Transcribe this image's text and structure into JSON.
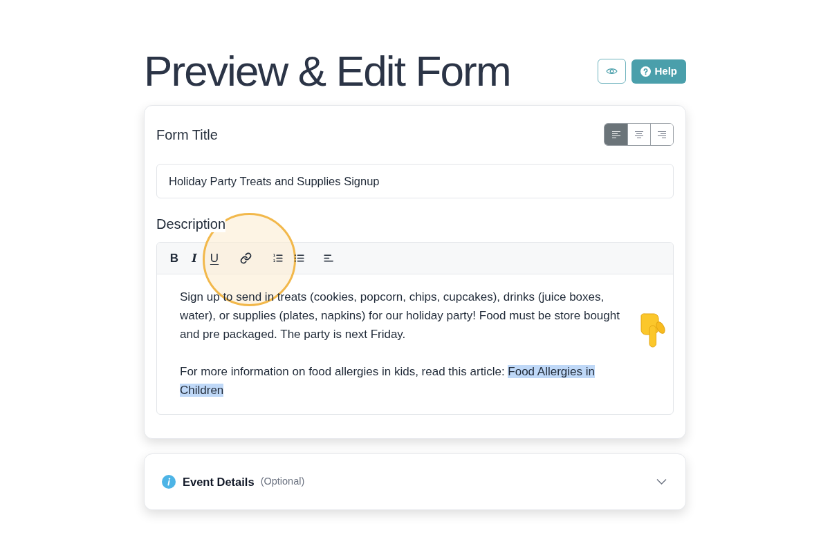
{
  "page": {
    "title": "Preview & Edit Form"
  },
  "header_buttons": [
    {
      "kind": "preview"
    },
    {
      "kind": "help",
      "label": "Help"
    }
  ],
  "form_card": {
    "title_label": "Form Title",
    "alignment": [
      {
        "kind": "left",
        "selected": true
      },
      {
        "kind": "center",
        "selected": false
      },
      {
        "kind": "right",
        "selected": false
      }
    ],
    "title_value": "Holiday Party Treats and Supplies Signup",
    "description_label": "Description",
    "toolbar": [
      {
        "kind": "bold",
        "label": "B"
      },
      {
        "kind": "italic",
        "label": "I"
      },
      {
        "kind": "underline",
        "label": "U"
      },
      {
        "kind": "link"
      },
      {
        "kind": "ordered-list"
      },
      {
        "kind": "bullet-list"
      },
      {
        "kind": "align-left"
      }
    ],
    "description": [
      {
        "segments": [
          {
            "text": "Sign up to send in treats (cookies, popcorn, chips, cupcakes), drinks (juice boxes, water), or supplies (plates, napkins) for our holiday party! Food must be store bought and pre packaged. The party is next Friday.",
            "selected": false
          }
        ]
      },
      {
        "segments": [
          {
            "text": "For more information on food allergies in kids, read this article: ",
            "selected": false
          },
          {
            "text": "Food Allergies in Children",
            "selected": true
          }
        ]
      }
    ]
  },
  "sections": [
    {
      "title": "Event Details",
      "note": "(Optional)",
      "expanded": false
    }
  ]
}
